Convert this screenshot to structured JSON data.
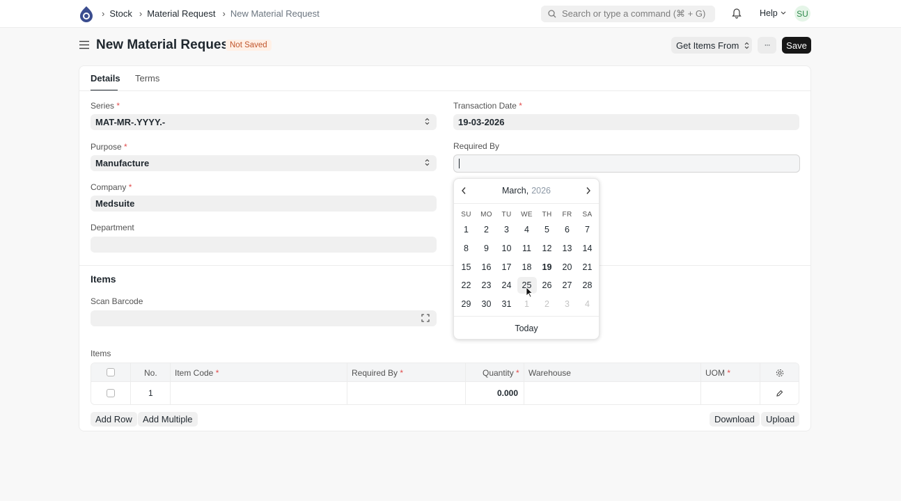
{
  "navbar": {
    "breadcrumbs": [
      "Stock",
      "Material Request",
      "New Material Request"
    ],
    "search_placeholder": "Search or type a command (⌘ + G)",
    "help_label": "Help",
    "avatar_initials": "SU"
  },
  "page": {
    "title": "New Material Request",
    "status": "Not Saved",
    "get_items_label": "Get Items From",
    "more_label": "···",
    "save_label": "Save"
  },
  "tabs": [
    "Details",
    "Terms"
  ],
  "fields": {
    "series_label": "Series",
    "series_value": "MAT-MR-.YYYY.-",
    "purpose_label": "Purpose",
    "purpose_value": "Manufacture",
    "company_label": "Company",
    "company_value": "Medsuite",
    "department_label": "Department",
    "department_value": "",
    "transaction_date_label": "Transaction Date",
    "transaction_date_value": "19-03-2026",
    "required_by_label": "Required By",
    "required_by_value": ""
  },
  "items_section": {
    "title": "Items",
    "scan_barcode_label": "Scan Barcode",
    "table_label": "Items",
    "columns": [
      "No.",
      "Item Code",
      "Required By",
      "Quantity",
      "Warehouse",
      "UOM"
    ],
    "rows": [
      {
        "no": "1",
        "item_code": "",
        "required_by": "",
        "quantity": "0.000",
        "warehouse": "",
        "uom": ""
      }
    ],
    "add_row_label": "Add Row",
    "add_multiple_label": "Add Multiple",
    "download_label": "Download",
    "upload_label": "Upload"
  },
  "datepicker": {
    "month": "March,",
    "year": "2026",
    "weekdays": [
      "SU",
      "MO",
      "TU",
      "WE",
      "TH",
      "FR",
      "SA"
    ],
    "weeks": [
      [
        "1",
        "2",
        "3",
        "4",
        "5",
        "6",
        "7"
      ],
      [
        "8",
        "9",
        "10",
        "11",
        "12",
        "13",
        "14"
      ],
      [
        "15",
        "16",
        "17",
        "18",
        "19",
        "20",
        "21"
      ],
      [
        "22",
        "23",
        "24",
        "25",
        "26",
        "27",
        "28"
      ],
      [
        "29",
        "30",
        "31",
        "1",
        "2",
        "3",
        "4"
      ]
    ],
    "today_day": "19",
    "hover_day": "25",
    "today_label": "Today"
  },
  "colors": {
    "accent": "#171717",
    "status_bg": "#fff0e6",
    "status_text": "#c0562c",
    "required_star": "#e24c4c"
  }
}
